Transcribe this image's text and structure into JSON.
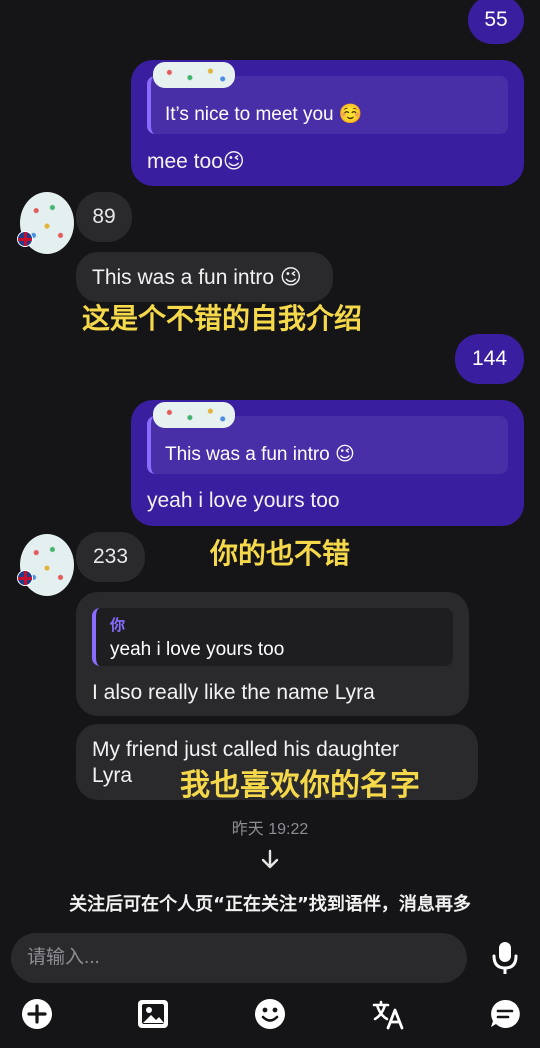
{
  "messages": {
    "out_count_1": "55",
    "out_msg_1": {
      "quote": "It’s nice to meet you ☺️",
      "text": "mee too😉"
    },
    "in_count_1": "89",
    "in_msg_1": {
      "text": "This was a fun intro 😉",
      "caption": "这是个不错的自我介绍"
    },
    "out_count_2": "144",
    "out_msg_2": {
      "quote": "This was a fun intro 😉",
      "text": "yeah i love yours too"
    },
    "in_count_2": "233",
    "in_caption_2": "你的也不错",
    "in_msg_2": {
      "quote_author": "你",
      "quote": "yeah i love yours too",
      "text": "I also really like the name Lyra"
    },
    "in_msg_3": {
      "text_line1": "My friend just called his daughter",
      "text_line2": "Lyra",
      "caption": "我也喜欢你的名字"
    }
  },
  "timestamp": "昨天 19:22",
  "notice": "关注后可在个人页“正在关注”找到语伴，消息再多",
  "composer": {
    "placeholder": "请输入..."
  },
  "toolbar": {
    "icons": [
      "add-icon",
      "image-icon",
      "emoji-icon",
      "translate-icon",
      "chat-icon"
    ]
  },
  "colors": {
    "outgoing": "#3a1ea0",
    "incoming": "#2a2a2d",
    "caption": "#f6d94a",
    "accent": "#8a6cff"
  }
}
